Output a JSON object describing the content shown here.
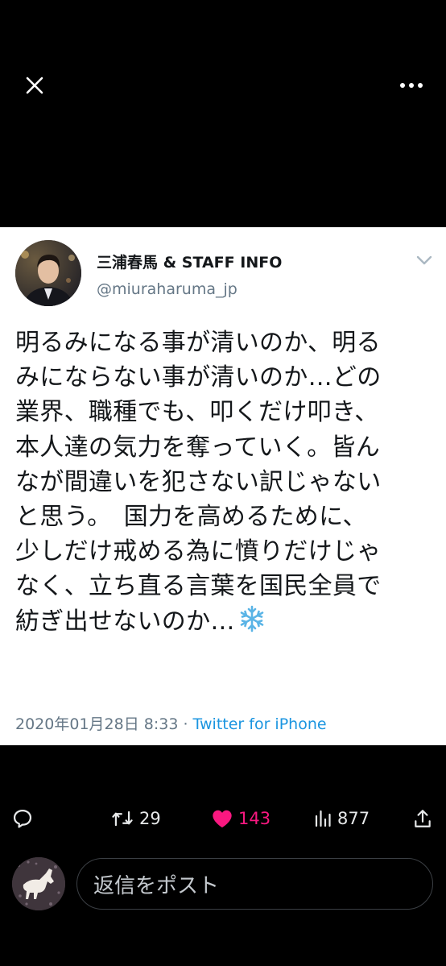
{
  "viewer": {
    "close_icon": "close-icon",
    "more_icon": "more-horizontal-icon"
  },
  "tweet": {
    "author_name": "三浦春馬 & STAFF INFO",
    "author_handle": "@miuraharuma_jp",
    "lines": [
      "明るみになる事が清いのか、明る",
      "みにならない事が清いのか…どの",
      "業界、職種でも、叩くだけ叩き、",
      "本人達の気力を奪っていく。皆ん",
      "なが間違いを犯さない訳じゃない",
      "と思う。　国力を高めるために、",
      "少しだけ戒める為に憤りだけじゃ",
      "なく、立ち直る言葉を国民全員で",
      "紡ぎ出せないのか…"
    ],
    "emoji": "snowflake-icon",
    "timestamp": "2020年01月28日 8:33 · ",
    "source": "Twitter for iPhone"
  },
  "actions": {
    "reply_icon": "reply-icon",
    "retweet_count": "29",
    "like_count": "143",
    "views_count": "877",
    "share_icon": "share-icon"
  },
  "reply": {
    "placeholder": "返信をポスト"
  },
  "colors": {
    "like": "#f91880",
    "link": "#1b95e0",
    "background": "#000000",
    "card": "#ffffff"
  }
}
